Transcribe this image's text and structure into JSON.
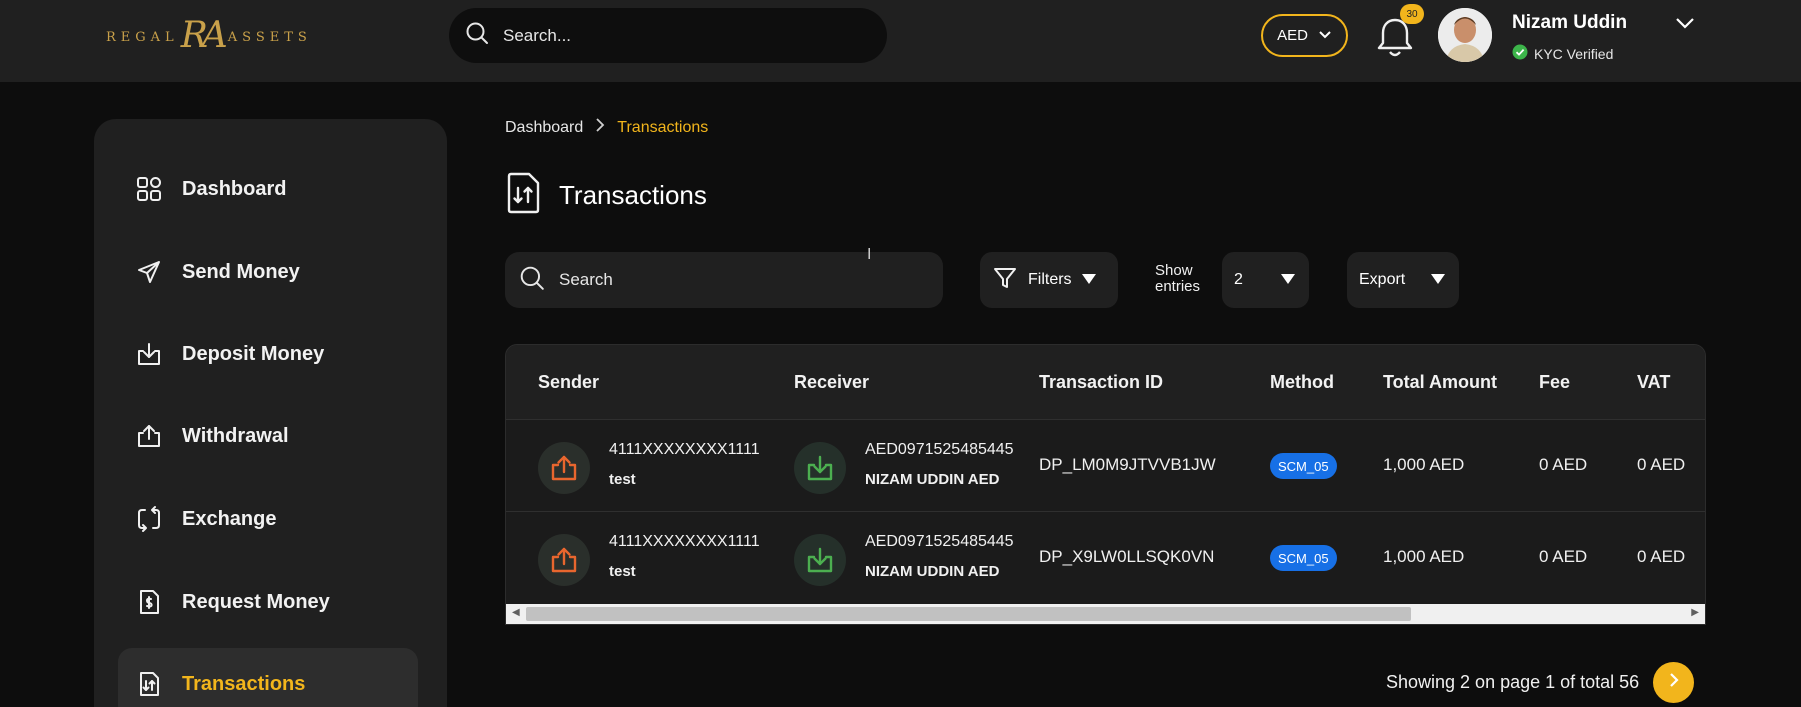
{
  "brand": {
    "word_left": "REGAL",
    "monogram": "RA",
    "word_right": "ASSETS",
    "color": "#c9a14a"
  },
  "header": {
    "search_placeholder": "Search...",
    "currency": "AED",
    "notification_count": "30",
    "user": {
      "name": "Nizam Uddin",
      "status": "KYC Verified"
    }
  },
  "sidebar": {
    "items": [
      {
        "label": "Dashboard",
        "icon": "grid-icon"
      },
      {
        "label": "Send Money",
        "icon": "send-icon"
      },
      {
        "label": "Deposit Money",
        "icon": "download-tray-icon"
      },
      {
        "label": "Withdrawal",
        "icon": "upload-tray-icon"
      },
      {
        "label": "Exchange",
        "icon": "exchange-icon"
      },
      {
        "label": "Request Money",
        "icon": "request-document-icon"
      },
      {
        "label": "Transactions",
        "icon": "transactions-document-icon",
        "active": true
      }
    ]
  },
  "breadcrumb": {
    "parent": "Dashboard",
    "current": "Transactions"
  },
  "page": {
    "title": "Transactions"
  },
  "toolbar": {
    "search_placeholder": "Search",
    "filters_label": "Filters",
    "show_entries_label_1": "Show",
    "show_entries_label_2": "entries",
    "entries_value": "2",
    "export_label": "Export"
  },
  "table": {
    "columns": [
      "Sender",
      "Receiver",
      "Transaction ID",
      "Method",
      "Total Amount",
      "Fee",
      "VAT"
    ],
    "rows": [
      {
        "sender_account": "4111XXXXXXXX1111",
        "sender_name": "test",
        "receiver_account": "AED0971525485445",
        "receiver_name": "NIZAM UDDIN AED",
        "transaction_id": "DP_LM0M9JTVVB1JW",
        "method": "SCM_05",
        "total_amount": "1,000 AED",
        "fee": "0 AED",
        "vat": "0 AED"
      },
      {
        "sender_account": "4111XXXXXXXX1111",
        "sender_name": "test",
        "receiver_account": "AED0971525485445",
        "receiver_name": "NIZAM UDDIN AED",
        "transaction_id": "DP_X9LW0LLSQK0VN",
        "method": "SCM_05",
        "total_amount": "1,000 AED",
        "fee": "0 AED",
        "vat": "0 AED"
      }
    ]
  },
  "pagination": {
    "summary": "Showing 2 on page 1 of total 56"
  },
  "colors": {
    "accent": "#f2b51c",
    "method_badge": "#1770e6",
    "sender_icon": "#e8662e",
    "receiver_icon": "#4caf50"
  }
}
